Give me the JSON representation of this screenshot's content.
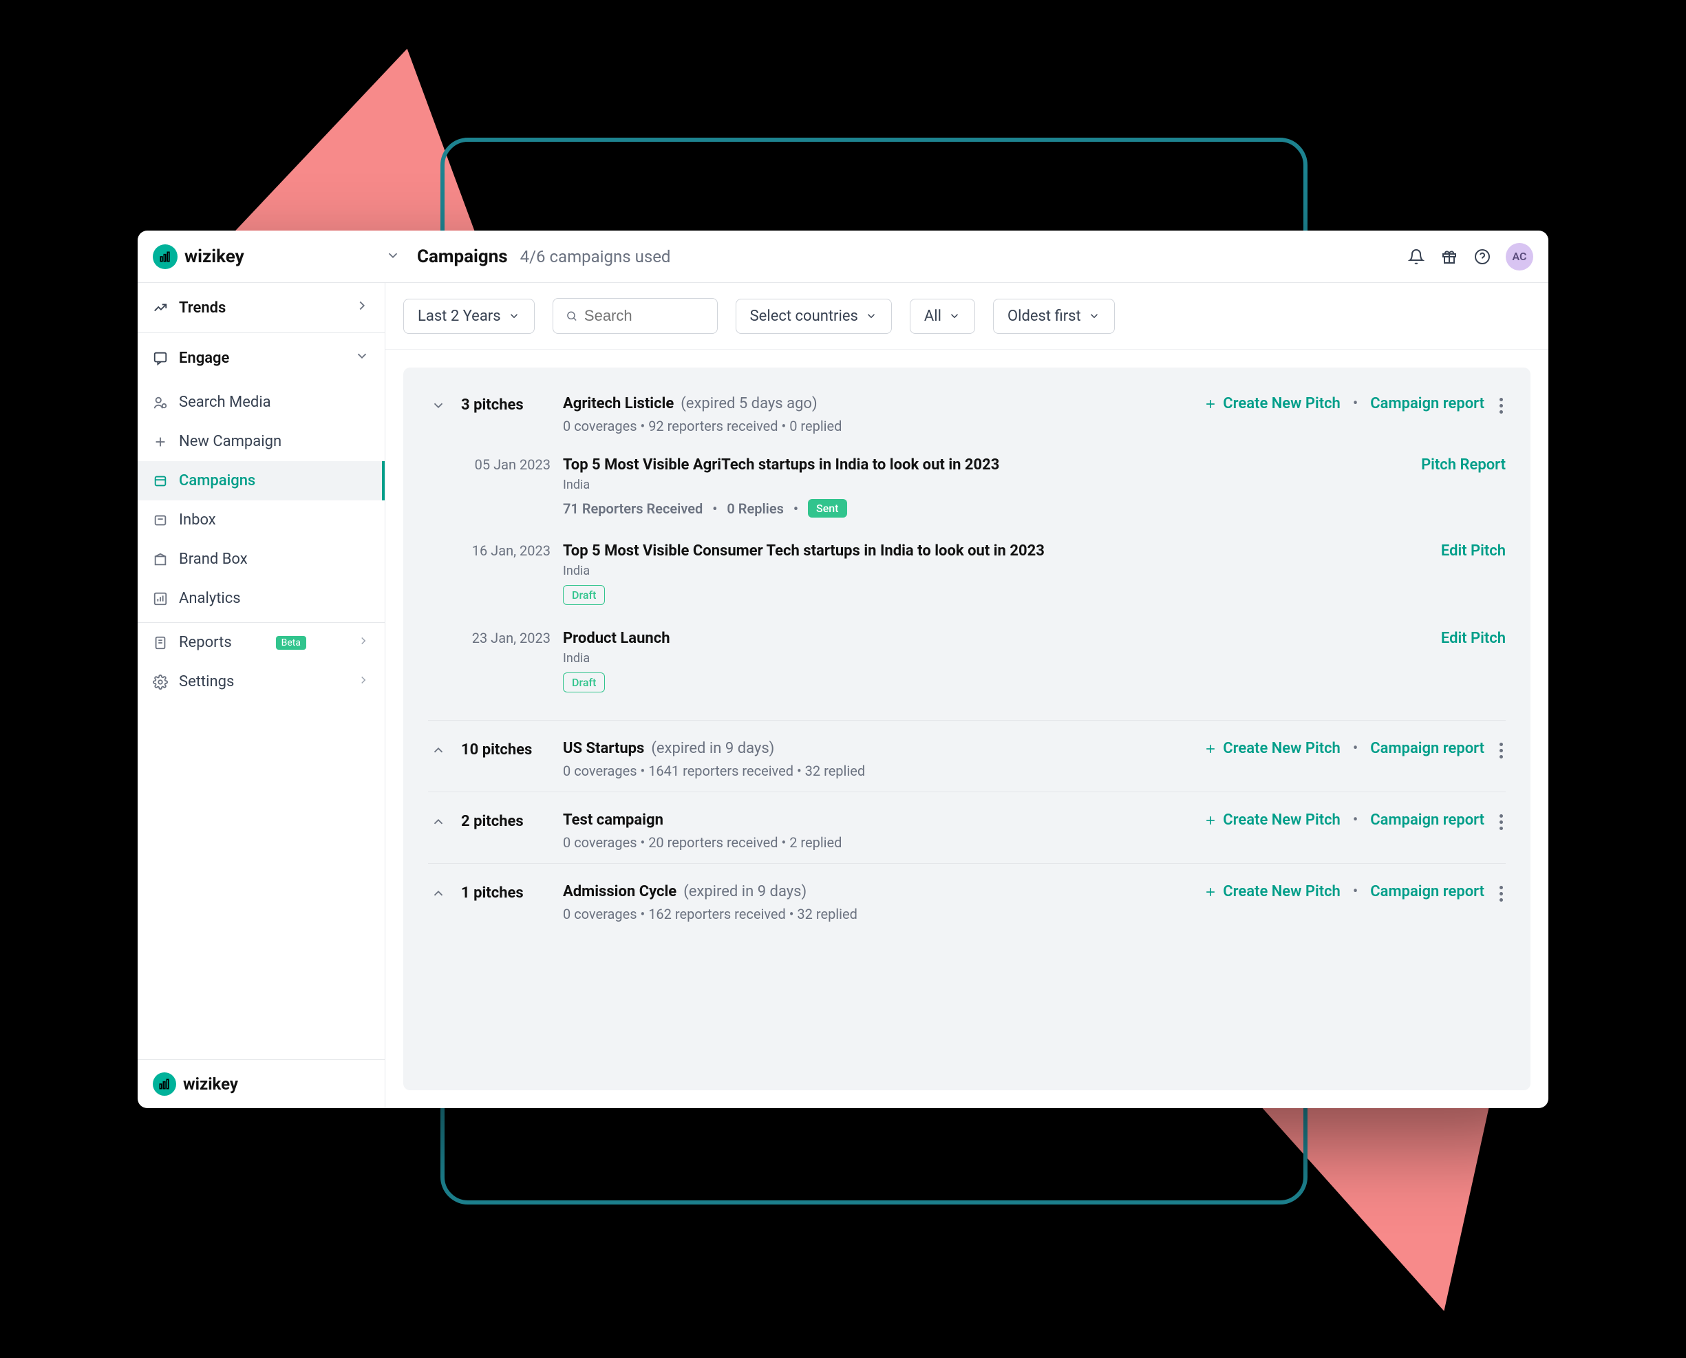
{
  "brand": {
    "name": "wizikey"
  },
  "header": {
    "title": "Campaigns",
    "subtitle": "4/6 campaigns used",
    "avatar_initials": "AC"
  },
  "sidebar": {
    "trends_label": "Trends",
    "engage_label": "Engage",
    "items": [
      {
        "label": "Search Media"
      },
      {
        "label": "New Campaign"
      },
      {
        "label": "Campaigns"
      },
      {
        "label": "Inbox"
      },
      {
        "label": "Brand Box"
      },
      {
        "label": "Analytics"
      }
    ],
    "reports_label": "Reports",
    "reports_badge": "Beta",
    "settings_label": "Settings"
  },
  "filters": {
    "range": "Last 2 Years",
    "search_placeholder": "Search",
    "countries": "Select countries",
    "kind": "All",
    "sort": "Oldest first"
  },
  "actions": {
    "create_new_pitch": "Create New Pitch",
    "campaign_report": "Campaign report",
    "pitch_report": "Pitch Report",
    "edit_pitch": "Edit Pitch"
  },
  "campaigns": [
    {
      "pitch_count": "3 pitches",
      "title": "Agritech Listicle",
      "expiry": "(expired 5 days ago)",
      "meta": "0 coverages • 92 reporters received • 0 replied",
      "pitches": [
        {
          "date": "05 Jan 2023",
          "title": "Top 5 Most Visible AgriTech startups in India to look out in 2023",
          "country": "India",
          "stats_reporters": "71 Reporters Received",
          "stats_replies": "0 Replies",
          "status": "Sent",
          "action": "Pitch Report"
        },
        {
          "date": "16 Jan, 2023",
          "title": "Top 5 Most Visible Consumer Tech startups in India to look out in 2023",
          "country": "India",
          "status": "Draft",
          "action": "Edit Pitch"
        },
        {
          "date": "23 Jan, 2023",
          "title": "Product Launch",
          "country": "India",
          "status": "Draft",
          "action": "Edit Pitch"
        }
      ]
    },
    {
      "pitch_count": "10 pitches",
      "title": "US Startups",
      "expiry": "(expired in 9 days)",
      "meta": "0 coverages • 1641 reporters received • 32 replied"
    },
    {
      "pitch_count": "2 pitches",
      "title": "Test campaign",
      "expiry": "",
      "meta": "0 coverages • 20 reporters received • 2 replied"
    },
    {
      "pitch_count": "1 pitches",
      "title": "Admission Cycle",
      "expiry": "(expired in 9 days)",
      "meta": "0 coverages • 162 reporters received • 32 replied"
    }
  ]
}
